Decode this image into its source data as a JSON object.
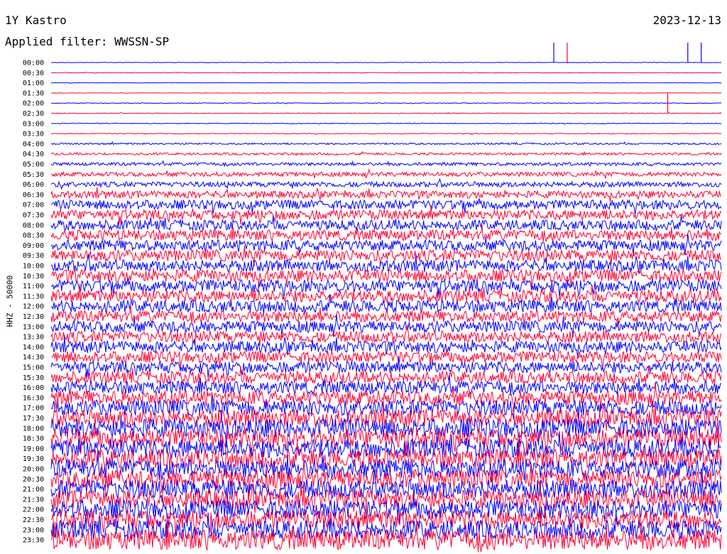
{
  "header": {
    "station": "1Y Kastro",
    "date": "2023-12-13",
    "filter_label": "Applied filter: WWSSN-SP"
  },
  "chart_data": {
    "type": "line",
    "title": "1Y Kastro",
    "subtitle": "Applied filter: WWSSN-SP",
    "ylabel": "HHZ - 50000",
    "xlabel": "",
    "colors": [
      "#0000ff",
      "#ff0033"
    ],
    "row_labels": [
      "00:00",
      "00:30",
      "01:00",
      "01:30",
      "02:00",
      "02:30",
      "03:00",
      "03:30",
      "04:00",
      "04:30",
      "05:00",
      "05:30",
      "06:00",
      "06:30",
      "07:00",
      "07:30",
      "08:00",
      "08:30",
      "09:00",
      "09:30",
      "10:00",
      "10:30",
      "11:00",
      "11:30",
      "12:00",
      "12:30",
      "13:00",
      "13:30",
      "14:00",
      "14:30",
      "15:00",
      "15:30",
      "16:00",
      "16:30",
      "17:00",
      "17:30",
      "18:00",
      "18:30",
      "19:00",
      "19:30",
      "20:00",
      "20:30",
      "21:00",
      "21:30",
      "22:00",
      "22:30",
      "23:00",
      "23:30"
    ],
    "series": [
      {
        "label": "00:00",
        "amplitude": 0.3
      },
      {
        "label": "00:30",
        "amplitude": 0.4
      },
      {
        "label": "01:00",
        "amplitude": 0.3
      },
      {
        "label": "01:30",
        "amplitude": 0.3
      },
      {
        "label": "02:00",
        "amplitude": 0.5
      },
      {
        "label": "02:30",
        "amplitude": 0.5
      },
      {
        "label": "03:00",
        "amplitude": 0.5
      },
      {
        "label": "03:30",
        "amplitude": 0.6
      },
      {
        "label": "04:00",
        "amplitude": 1.2
      },
      {
        "label": "04:30",
        "amplitude": 1.6
      },
      {
        "label": "05:00",
        "amplitude": 2.2
      },
      {
        "label": "05:30",
        "amplitude": 3.0
      },
      {
        "label": "06:00",
        "amplitude": 3.6
      },
      {
        "label": "06:30",
        "amplitude": 5.0
      },
      {
        "label": "07:00",
        "amplitude": 6.5
      },
      {
        "label": "07:30",
        "amplitude": 7.0
      },
      {
        "label": "08:00",
        "amplitude": 7.0
      },
      {
        "label": "08:30",
        "amplitude": 7.5
      },
      {
        "label": "09:00",
        "amplitude": 7.5
      },
      {
        "label": "09:30",
        "amplitude": 8.0
      },
      {
        "label": "10:00",
        "amplitude": 8.0
      },
      {
        "label": "10:30",
        "amplitude": 8.5
      },
      {
        "label": "11:00",
        "amplitude": 8.5
      },
      {
        "label": "11:30",
        "amplitude": 8.5
      },
      {
        "label": "12:00",
        "amplitude": 8.5
      },
      {
        "label": "12:30",
        "amplitude": 8.0
      },
      {
        "label": "13:00",
        "amplitude": 8.0
      },
      {
        "label": "13:30",
        "amplitude": 8.0
      },
      {
        "label": "14:00",
        "amplitude": 8.0
      },
      {
        "label": "14:30",
        "amplitude": 8.0
      },
      {
        "label": "15:00",
        "amplitude": 8.0
      },
      {
        "label": "15:30",
        "amplitude": 8.5
      },
      {
        "label": "16:00",
        "amplitude": 9.0
      },
      {
        "label": "16:30",
        "amplitude": 10.0
      },
      {
        "label": "17:00",
        "amplitude": 11.0
      },
      {
        "label": "17:30",
        "amplitude": 12.0
      },
      {
        "label": "18:00",
        "amplitude": 13.0
      },
      {
        "label": "18:30",
        "amplitude": 13.0
      },
      {
        "label": "19:00",
        "amplitude": 13.0
      },
      {
        "label": "19:30",
        "amplitude": 13.0
      },
      {
        "label": "20:00",
        "amplitude": 13.0
      },
      {
        "label": "20:30",
        "amplitude": 13.0
      },
      {
        "label": "21:00",
        "amplitude": 13.0
      },
      {
        "label": "21:30",
        "amplitude": 13.0
      },
      {
        "label": "22:00",
        "amplitude": 13.0
      },
      {
        "label": "22:30",
        "amplitude": 13.0
      },
      {
        "label": "23:00",
        "amplitude": 13.0
      },
      {
        "label": "23:30",
        "amplitude": 14.0
      }
    ],
    "spikes": [
      {
        "x_frac": 0.92,
        "row": "02:30",
        "color": "red"
      },
      {
        "x_frac": 0.95,
        "row": "00:00",
        "color": "blue"
      },
      {
        "x_frac": 0.97,
        "row": "00:00",
        "color": "blue"
      },
      {
        "x_frac": 0.75,
        "row": "00:00",
        "color": "blue"
      },
      {
        "x_frac": 0.77,
        "row": "00:00",
        "color": "red"
      }
    ]
  }
}
